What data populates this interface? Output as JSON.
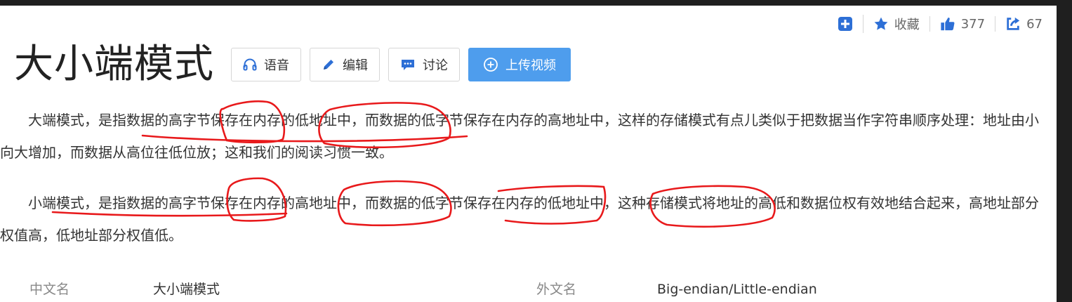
{
  "actions": {
    "add_icon": "plus-square-icon",
    "favorite_icon": "star-icon",
    "favorite_label": "收藏",
    "like_icon": "thumbs-up-icon",
    "like_count": "377",
    "share_icon": "share-icon",
    "share_count": "67"
  },
  "title": "大小端模式",
  "toolbar": {
    "voice_icon": "headphones-icon",
    "voice_label": "语音",
    "edit_icon": "pencil-icon",
    "edit_label": "编辑",
    "discuss_icon": "comment-icon",
    "discuss_label": "讨论",
    "upload_icon": "plus-circle-icon",
    "upload_label": "上传视频",
    "upload_color": "#4e9ded"
  },
  "paragraphs": [
    "大端模式，是指数据的高字节保存在内存的低地址中，而数据的低字节保存在内存的高地址中，这样的存储模式有点儿类似于把数据当作字符串顺序处理：地址由小向大增加，而数据从高位往低位放；这和我们的阅读习惯一致。",
    "小端模式，是指数据的高字节保存在内存的高地址中，而数据的低字节保存在内存的低地址中，这种存储模式将地址的高低和数据位权有效地结合起来，高地址部分权值高，低地址部分权值低。"
  ],
  "info": {
    "chinese_name_label": "中文名",
    "chinese_name_value": "大小端模式",
    "foreign_name_label": "外文名",
    "foreign_name_value": "Big-endian/Little-endian"
  },
  "annotation_color": "#e8191b"
}
